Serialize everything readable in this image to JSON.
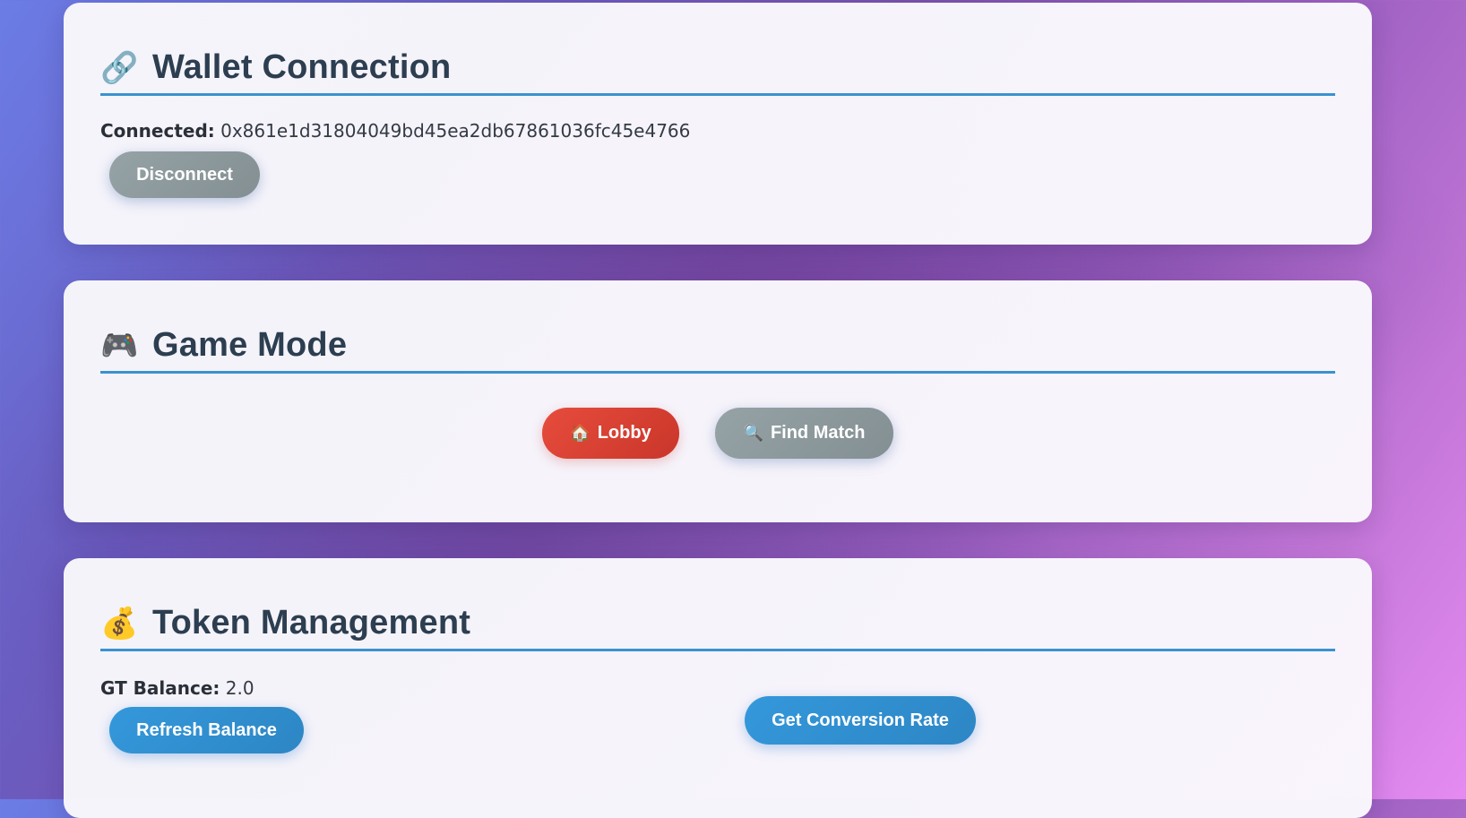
{
  "wallet": {
    "icon": "link-icon",
    "icon_glyph": "🔗",
    "title": "Wallet Connection",
    "connected_label": "Connected:",
    "address": "0x861e1d31804049bd45ea2db67861036fc45e4766",
    "disconnect_label": "Disconnect"
  },
  "game_mode": {
    "icon": "gamepad-icon",
    "icon_glyph": "🎮",
    "title": "Game Mode",
    "lobby_icon_glyph": "🏠",
    "lobby_label": "Lobby",
    "find_match_icon_glyph": "🔍",
    "find_match_label": "Find Match"
  },
  "tokens": {
    "icon": "money-bag-icon",
    "icon_glyph": "💰",
    "title": "Token Management",
    "balance_label": "GT Balance:",
    "balance_value": "2.0",
    "refresh_label": "Refresh Balance",
    "conversion_label": "Get Conversion Rate"
  },
  "colors": {
    "accent": "#3498db",
    "danger": "#e74c3c",
    "muted": "#95a5a6",
    "heading": "#2c3e50"
  }
}
